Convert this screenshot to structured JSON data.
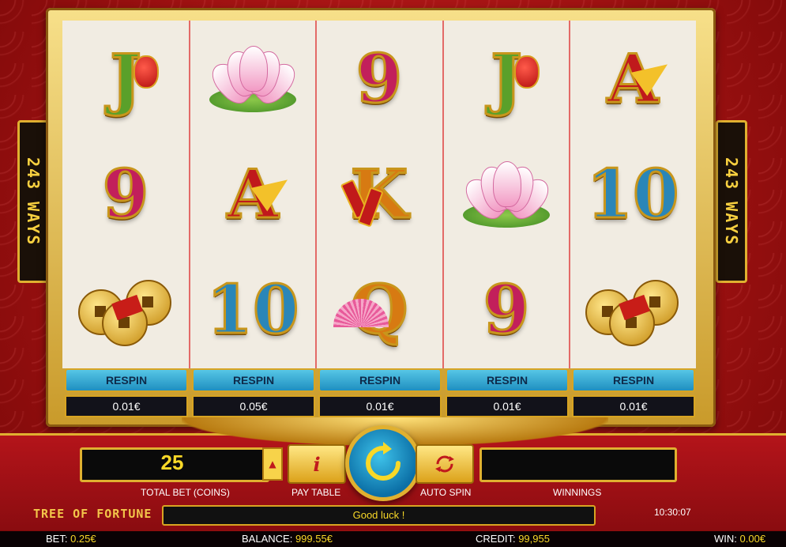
{
  "game": {
    "title": "TREE OF FORTUNE",
    "ways_badge": "243 WAYS"
  },
  "reels": [
    {
      "symbols": [
        "J",
        "9",
        "coins"
      ]
    },
    {
      "symbols": [
        "lotus",
        "A",
        "10"
      ]
    },
    {
      "symbols": [
        "9",
        "K",
        "Q"
      ]
    },
    {
      "symbols": [
        "J",
        "lotus",
        "9"
      ]
    },
    {
      "symbols": [
        "A",
        "10",
        "coins"
      ]
    }
  ],
  "respin": {
    "label": "RESPIN",
    "prices": [
      "0.01€",
      "0.05€",
      "0.01€",
      "0.01€",
      "0.01€"
    ]
  },
  "controls": {
    "total_bet_value": "25",
    "total_bet_label": "TOTAL BET (COINS)",
    "pay_table_label": "PAY TABLE",
    "auto_spin_label": "AUTO SPIN",
    "winnings_label": "WINNINGS",
    "winnings_value": "",
    "status_message": "Good luck !",
    "clock": "10:30:07"
  },
  "footer": {
    "bet_label": "BET:",
    "bet_value": "0.25€",
    "balance_label": "BALANCE:",
    "balance_value": "999.55€",
    "credit_label": "CREDIT:",
    "credit_value": "99,955",
    "win_label": "WIN:",
    "win_value": "0.00€"
  },
  "icons": {
    "info": "i",
    "spin": "spin-icon",
    "autospin": "autospin-icon",
    "bet_up": "▲"
  },
  "colors": {
    "accent_gold": "#e0b030",
    "panel_red": "#b4141a",
    "value_yellow": "#f8d828",
    "respin_blue": "#1f8fc0"
  }
}
